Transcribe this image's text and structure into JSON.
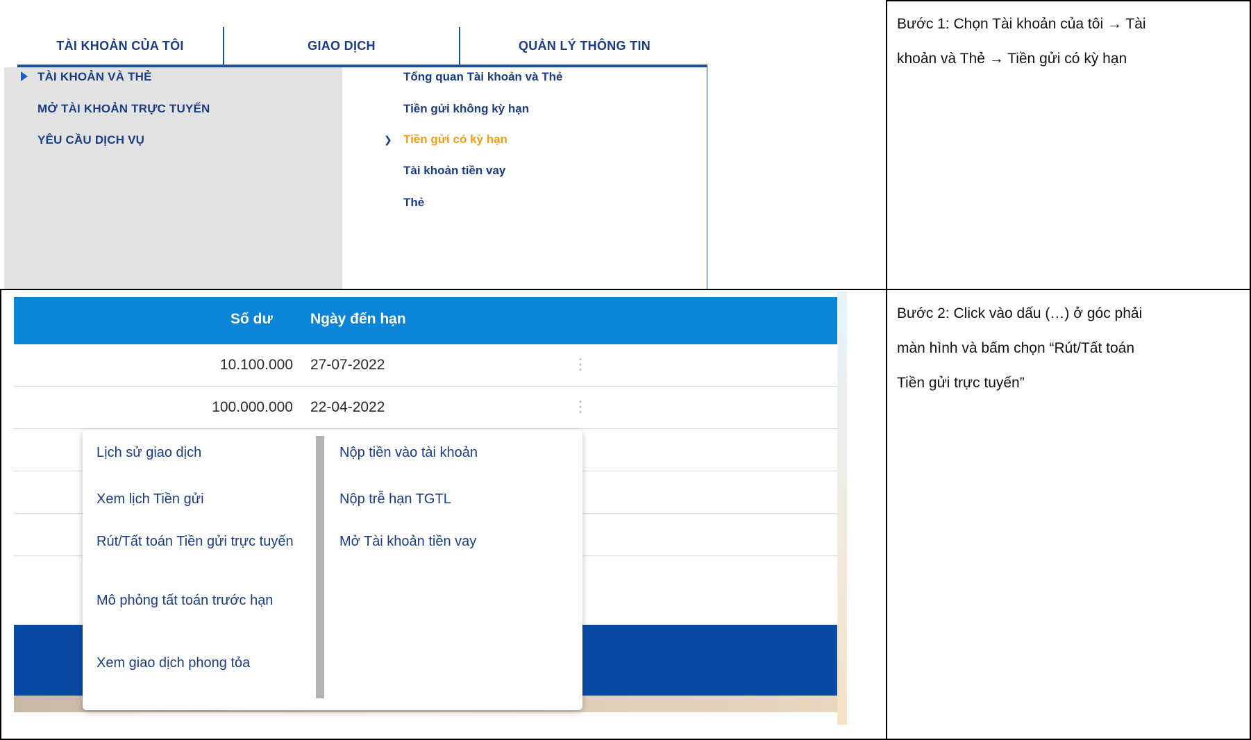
{
  "step1": {
    "nav_tabs": [
      "TÀI KHOẢN CỦA TÔI",
      "GIAO DỊCH",
      "QUẢN LÝ THÔNG TIN"
    ],
    "left_menu": [
      "TÀI KHOẢN VÀ THẺ",
      "MỞ TÀI KHOẢN TRỰC TUYẾN",
      "YÊU CẦU DỊCH VỤ"
    ],
    "right_menu": [
      "Tổng quan Tài khoản và Thẻ",
      "Tiền gửi không kỳ hạn",
      "Tiền gửi có kỳ hạn",
      "Tài khoản tiền vay",
      "Thẻ"
    ],
    "instruction_line1": "Bước 1: Chọn Tài khoản của tôi → Tài",
    "instruction_line2": "khoản và Thẻ → Tiền gửi có kỳ hạn"
  },
  "step2": {
    "headers": {
      "balance": "Số dư",
      "due_date": "Ngày đến hạn"
    },
    "rows": [
      {
        "balance": "10.100.000",
        "due_date": "27-07-2022",
        "menu": "⋮"
      },
      {
        "balance": "100.000.000",
        "due_date": "22-04-2022",
        "menu": "⋮"
      }
    ],
    "context_menu_left": [
      "Lịch sử giao dịch",
      "Xem lịch Tiền gửi",
      "Rút/Tất toán Tiền gửi trực tuyến",
      "Mô phỏng tất toán trước hạn",
      "Xem giao dịch phong tỏa"
    ],
    "context_menu_right": [
      "Nộp tiền vào tài khoản",
      "Nộp trễ hạn TGTL",
      "Mở Tài khoản tiền vay"
    ],
    "instruction_line1": " Bước 2: Click vào dấu (…) ở góc phải",
    "instruction_line2": "màn hình và bấm chọn “Rút/Tất toán",
    "instruction_line3": "Tiền gửi trực tuyến”"
  },
  "colors": {
    "nav_text": "#1a3c86",
    "active": "#f59a12",
    "header_blue": "#0a84d6",
    "band_blue": "#0b4aa2"
  }
}
